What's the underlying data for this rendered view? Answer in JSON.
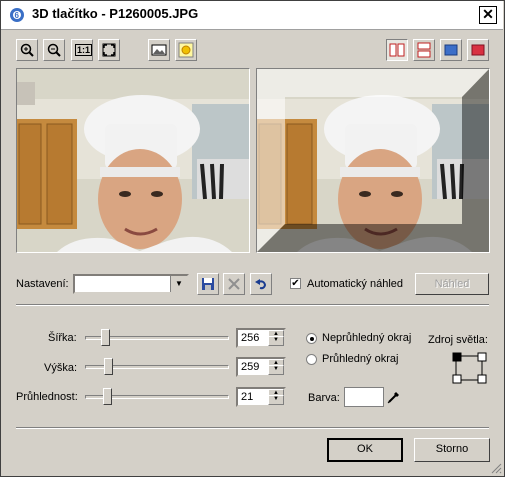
{
  "window": {
    "title": "3D tlačítko - P1260005.JPG"
  },
  "icons": {
    "app": "app-3d-icon",
    "close": "close-icon",
    "zoom_in": "zoom-in-icon",
    "zoom_out": "zoom-out-icon",
    "actual_size_label": "1:1",
    "fit": "fit-to-window-icon",
    "landscape": "landscape-icon",
    "sun": "sun-icon",
    "split_v": "split-vertical-icon",
    "split_h": "split-horizontal-icon",
    "single_blue": "single-view-icon",
    "single_red": "single-view-red-icon"
  },
  "settings": {
    "label": "Nastavení:",
    "preset_value": "",
    "save_icon": "save-icon",
    "delete_icon": "delete-icon",
    "undo_icon": "undo-icon",
    "auto_preview_label": "Automatický náhled",
    "auto_preview_checked": true,
    "preview_button": "Náhled"
  },
  "params": {
    "width_label": "Šířka:",
    "width_value": "256",
    "width_level": 0.12,
    "height_label": "Výška:",
    "height_value": "259",
    "height_level": 0.14,
    "transparency_label": "Průhlednost:",
    "transparency_value": "21",
    "transparency_level": 0.13
  },
  "edge": {
    "opaque_label": "Neprůhledný okraj",
    "transparent_label": "Průhledný okraj",
    "selected": "opaque"
  },
  "light_source": {
    "label": "Zdroj světla:",
    "selected": "top-left"
  },
  "color": {
    "label": "Barva:",
    "value": "#ffffff",
    "picker_icon": "eyedropper-icon"
  },
  "buttons": {
    "ok": "OK",
    "cancel": "Storno"
  }
}
